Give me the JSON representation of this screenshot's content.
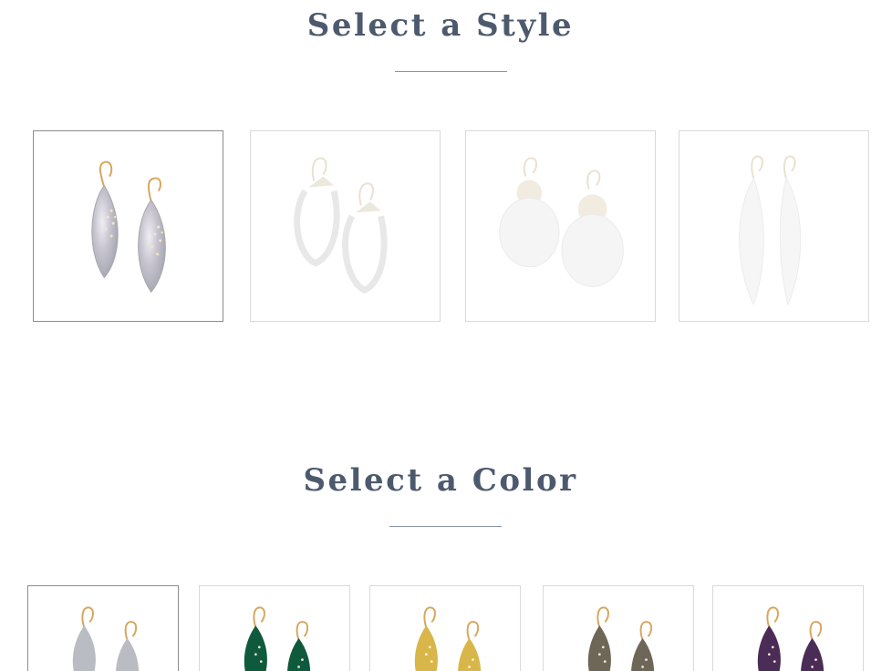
{
  "style_section": {
    "title": "Select a Style",
    "options": [
      {
        "icon": "leaf-earring-icon",
        "selected": true
      },
      {
        "icon": "hoop-earring-icon",
        "selected": false
      },
      {
        "icon": "disc-drop-earring-icon",
        "selected": false
      },
      {
        "icon": "sliver-earring-icon",
        "selected": false
      }
    ]
  },
  "color_section": {
    "title": "Select a Color",
    "options": [
      {
        "icon": "leaf-earring-icon",
        "color": "#b9bcc3",
        "selected": true
      },
      {
        "icon": "leaf-earring-icon",
        "color": "#0f5a3c",
        "selected": false
      },
      {
        "icon": "leaf-earring-icon",
        "color": "#d8b64a",
        "selected": false
      },
      {
        "icon": "leaf-earring-icon",
        "color": "#6e6657",
        "selected": false
      },
      {
        "icon": "leaf-earring-icon",
        "color": "#4b2c57",
        "selected": false
      }
    ]
  },
  "colors": {
    "heading": "#4d5a6e",
    "hook_gold": "#d7a65e"
  }
}
